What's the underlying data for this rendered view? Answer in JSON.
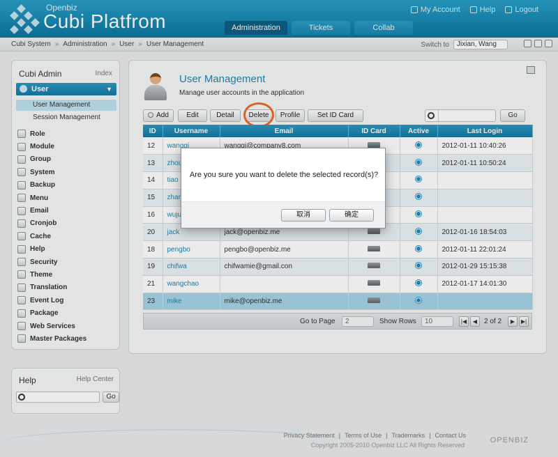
{
  "header": {
    "brand_small": "Openbiz",
    "brand_big": "Cubi Platfrom",
    "links": [
      "My Account",
      "Help",
      "Logout"
    ],
    "tabs": [
      "Administration",
      "Tickets",
      "Collab"
    ],
    "active_tab": "Administration"
  },
  "breadcrumb": [
    "Cubi System",
    "Administration",
    "User",
    "User Management"
  ],
  "switch": {
    "label": "Switch to",
    "value": "Jixian, Wang"
  },
  "sidebar": {
    "title": "Cubi Admin",
    "index_label": "Index",
    "section": "User",
    "subitems": [
      "User Management",
      "Session Management"
    ],
    "items": [
      "Role",
      "Module",
      "Group",
      "System",
      "Backup",
      "Menu",
      "Email",
      "Cronjob",
      "Cache",
      "Help",
      "Security",
      "Theme",
      "Translation",
      "Event Log",
      "Package",
      "Web Services",
      "Master Packages"
    ]
  },
  "help": {
    "title": "Help",
    "link": "Help Center",
    "go": "Go"
  },
  "page": {
    "title": "User Management",
    "description": "Manage user accounts in the application"
  },
  "toolbar": {
    "add": "Add",
    "edit": "Edit",
    "detail": "Detail",
    "delete": "Delete",
    "profile": "Profile",
    "set_id_card": "Set ID Card",
    "go": "Go"
  },
  "table": {
    "columns": [
      "ID",
      "Username",
      "Email",
      "ID Card",
      "Active",
      "Last Login"
    ],
    "rows": [
      {
        "id": "12",
        "username": "wangqi",
        "email": "wangqi@company8.com",
        "last": "2012-01-11 10:40:26"
      },
      {
        "id": "13",
        "username": "zhou",
        "email": "",
        "last": "2012-01-11 10:50:24"
      },
      {
        "id": "14",
        "username": "tiao",
        "email": "",
        "last": ""
      },
      {
        "id": "15",
        "username": "zhan",
        "email": "",
        "last": ""
      },
      {
        "id": "16",
        "username": "wuju",
        "email": "",
        "last": ""
      },
      {
        "id": "20",
        "username": "jack",
        "email": "jack@openbiz.me",
        "last": "2012-01-16 18:54:03"
      },
      {
        "id": "18",
        "username": "pengbo",
        "email": "pengbo@openbiz.me",
        "last": "2012-01-11 22:01:24"
      },
      {
        "id": "19",
        "username": "chifwa",
        "email": "chifwamie@gmail.con",
        "last": "2012-01-29 15:15:38"
      },
      {
        "id": "21",
        "username": "wangchao",
        "email": "",
        "last": "2012-01-17 14:01:30"
      },
      {
        "id": "23",
        "username": "mike",
        "email": "mike@openbiz.me",
        "last": ""
      }
    ]
  },
  "pager": {
    "go_to_page": "Go to Page",
    "page_value": "2",
    "show_rows": "Show Rows",
    "rows_value": "10",
    "page_info": "2 of 2"
  },
  "dialog": {
    "message": "Are you sure you want to delete the selected record(s)?",
    "cancel": "取消",
    "ok": "确定"
  },
  "footer": {
    "links": [
      "Privacy Statement",
      "Terms of Use",
      "Trademarks",
      "Contact Us"
    ],
    "copyright": "Copyright 2005-2010 Openbiz LLC All Rights Reserved",
    "logo": "OPENBIZ"
  }
}
